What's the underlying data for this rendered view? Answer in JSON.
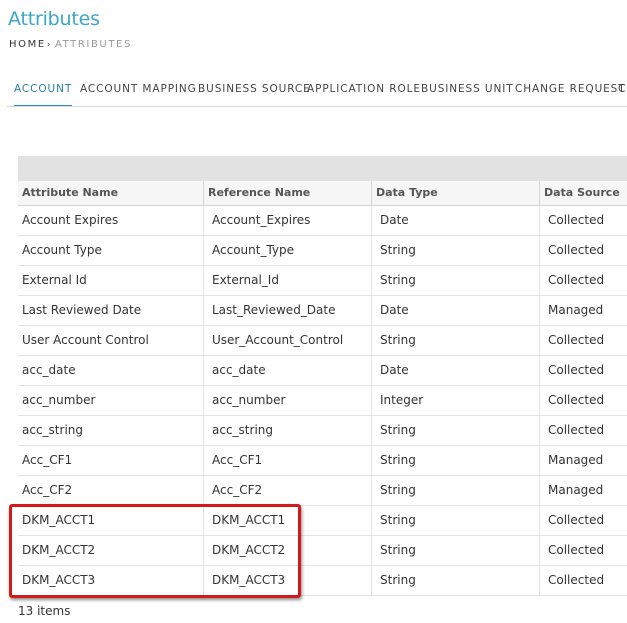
{
  "page": {
    "title": "Attributes"
  },
  "breadcrumb": {
    "home": "HOME",
    "separator": "›",
    "current": "ATTRIBUTES"
  },
  "tabs": [
    {
      "label": "ACCOUNT",
      "active": true
    },
    {
      "label": "ACCOUNT MAPPING"
    },
    {
      "label": "BUSINESS SOURCE"
    },
    {
      "label": "APPLICATION ROLE"
    },
    {
      "label": "BUSINESS UNIT"
    },
    {
      "label": "CHANGE REQUEST"
    }
  ],
  "tab_overflow": "C",
  "grid": {
    "columns": [
      "Attribute Name",
      "Reference Name",
      "Data Type",
      "Data Source"
    ],
    "rows": [
      [
        "Account Expires",
        "Account_Expires",
        "Date",
        "Collected"
      ],
      [
        "Account Type",
        "Account_Type",
        "String",
        "Collected"
      ],
      [
        "External Id",
        "External_Id",
        "String",
        "Collected"
      ],
      [
        "Last Reviewed Date",
        "Last_Reviewed_Date",
        "Date",
        "Managed"
      ],
      [
        "User Account Control",
        "User_Account_Control",
        "String",
        "Collected"
      ],
      [
        "acc_date",
        "acc_date",
        "Date",
        "Collected"
      ],
      [
        "acc_number",
        "acc_number",
        "Integer",
        "Collected"
      ],
      [
        "acc_string",
        "acc_string",
        "String",
        "Collected"
      ],
      [
        "Acc_CF1",
        "Acc_CF1",
        "String",
        "Managed"
      ],
      [
        "Acc_CF2",
        "Acc_CF2",
        "String",
        "Managed"
      ],
      [
        "DKM_ACCT1",
        "DKM_ACCT1",
        "String",
        "Collected"
      ],
      [
        "DKM_ACCT2",
        "DKM_ACCT2",
        "String",
        "Collected"
      ],
      [
        "DKM_ACCT3",
        "DKM_ACCT3",
        "String",
        "Collected"
      ]
    ],
    "item_count": "13 items"
  },
  "colors": {
    "accent": "#3aa6c8",
    "highlight": "#d21a1a"
  }
}
